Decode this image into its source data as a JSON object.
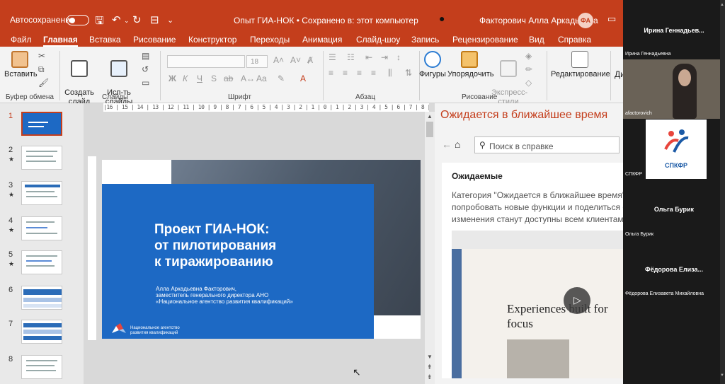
{
  "titlebar": {
    "autosave": "Автосохранение",
    "doc_title": "Опыт ГИА-НОК • Сохранено в: этот компьютер",
    "user": "Факторович Алла Аркадьевна",
    "initials": "ФА"
  },
  "tabs": [
    "Файл",
    "Главная",
    "Вставка",
    "Рисование",
    "Конструктор",
    "Переходы",
    "Анимация",
    "Слайд-шоу",
    "Запись",
    "Рецензирование",
    "Вид",
    "Справка"
  ],
  "ribbon": {
    "paste": "Вставить",
    "clipboard_group": "Буфер обмена",
    "new_slide": "Создать\nслайд",
    "reuse": "Исп-ть\nслайды снова",
    "slides_group": "Слайды",
    "font_size": "18",
    "font_group": "Шрифт",
    "paragraph_group": "Абзац",
    "shapes": "Фигуры",
    "arrange": "Упорядочить",
    "quick_styles": "Экспресс-\nстили",
    "drawing_group": "Рисование",
    "editing": "Редактирование",
    "design_partial": "Ди"
  },
  "slides": [
    {
      "num": "1",
      "star": ""
    },
    {
      "num": "2",
      "star": "★"
    },
    {
      "num": "3",
      "star": "★"
    },
    {
      "num": "4",
      "star": "★"
    },
    {
      "num": "5",
      "star": "★"
    },
    {
      "num": "6",
      "star": ""
    },
    {
      "num": "7",
      "star": ""
    },
    {
      "num": "8",
      "star": ""
    }
  ],
  "ruler_h": "|16 | 15 | 14 | 13 | 12 | 11 | 10 | 9 | 8 | 7 | 6 | 5 | 4 | 3 | 2 | 1 | 0 | 1 | 2 | 3 | 4 | 5 | 6 | 7 | 8 | 9 | 10 | 11 | 12 | 13 | 14 | 15 | 16",
  "slide": {
    "title": "Проект ГИА-НОК:\nот пилотирования\nк тиражированию",
    "subtitle": "Алла Аркадьевна Факторович,\nзаместитель генерального директора АНО\n«Национальное агентство развития квалификаций»",
    "org": "Национальное агентство\nразвития квалификаций"
  },
  "help": {
    "title": "Ожидается в ближайшее время",
    "search_placeholder": "Поиск в справке",
    "card_title": "Ожидаемые",
    "card_text": "Категория \"Ожидается в ближайшее время\" да попробовать новые функции и поделиться отз как изменения станут доступны всем клиентам",
    "video_heading": "Experiences built for focus"
  },
  "participants": [
    {
      "top_name": "Ирина  Геннадьев...",
      "caption": "Ирина Геннадьевна"
    },
    {
      "caption": "afactorovich"
    },
    {
      "caption": "СПКФР",
      "logo_text": "СПКФР"
    },
    {
      "top_name": "Ольга Бурик",
      "caption": "Ольга Бурик"
    },
    {
      "top_name": "Фёдорова  Елиза...",
      "caption": "Фёдорова Елизавета Михайловна"
    }
  ],
  "colors": {
    "accent": "#c43e1c",
    "slide_blue": "#1d69c4",
    "spkfr_blue": "#1b5aa6"
  }
}
